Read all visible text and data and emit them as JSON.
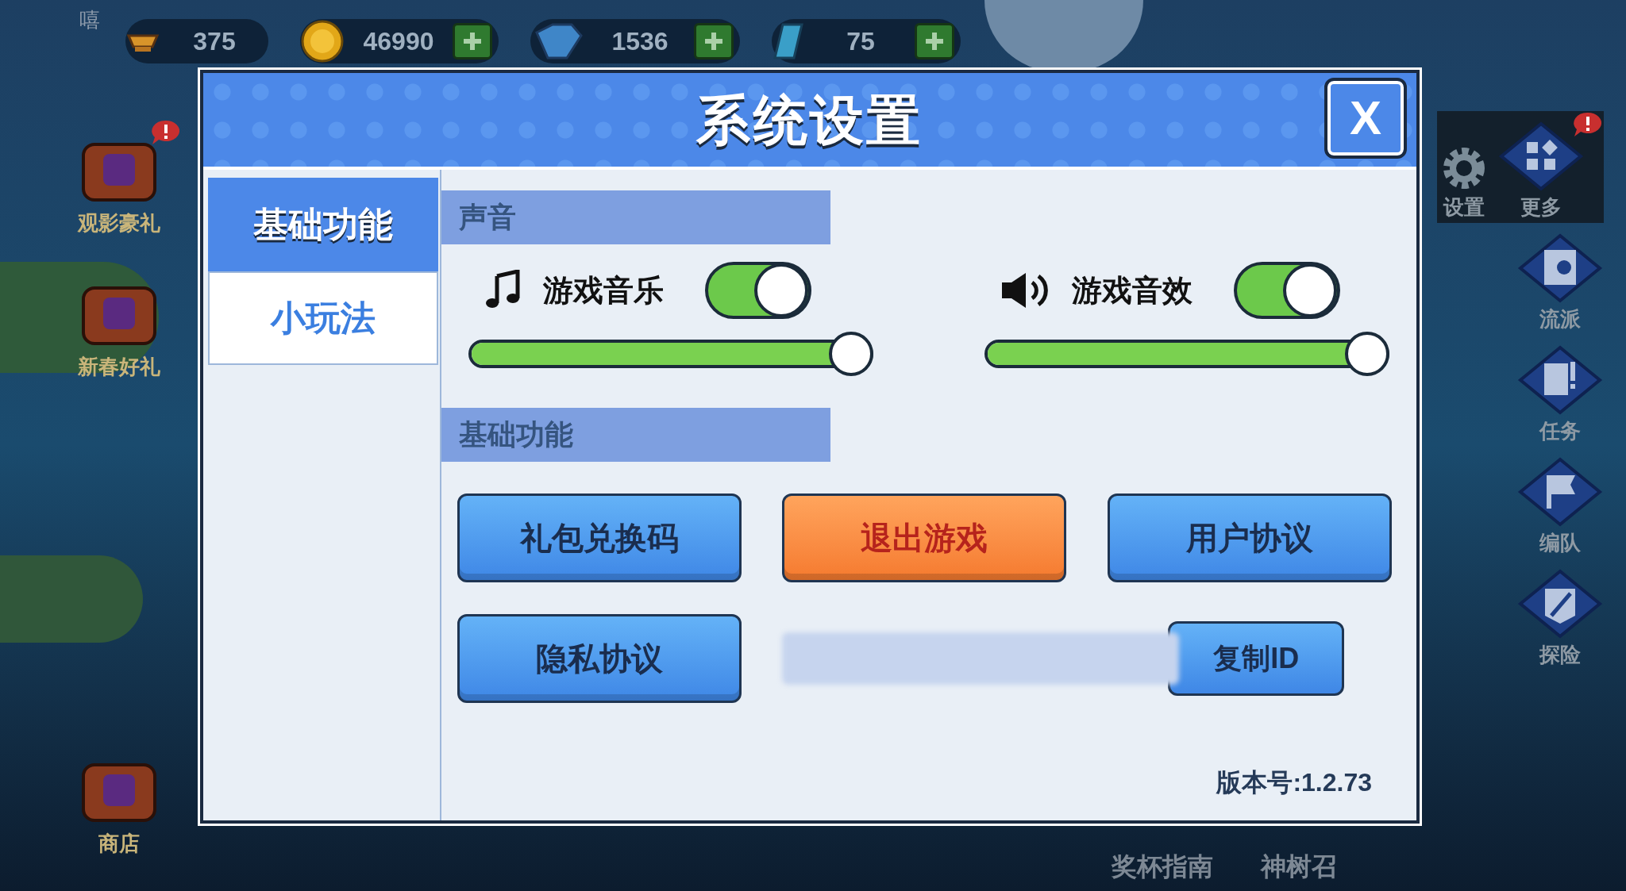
{
  "top_bar": {
    "player_label": "嘻",
    "currencies": [
      {
        "kind": "trophy",
        "amount": "375",
        "addable": false
      },
      {
        "kind": "coin",
        "amount": "46990",
        "addable": true
      },
      {
        "kind": "gem",
        "amount": "1536",
        "addable": true
      },
      {
        "kind": "crystal",
        "amount": "75",
        "addable": true
      }
    ]
  },
  "left_menu": [
    {
      "label": "观影豪礼",
      "alert": true
    },
    {
      "label": "新春好礼",
      "alert": false
    },
    {
      "label": "商店",
      "alert": false
    }
  ],
  "right_menu": [
    {
      "label": "设置",
      "kind": "gear",
      "alert": false
    },
    {
      "label": "更多",
      "kind": "grid",
      "alert": true
    },
    {
      "label": "流派",
      "kind": "book",
      "alert": false
    },
    {
      "label": "任务",
      "kind": "scroll",
      "alert": false
    },
    {
      "label": "编队",
      "kind": "flag",
      "alert": false
    },
    {
      "label": "探险",
      "kind": "sword",
      "alert": false
    }
  ],
  "bottom_bar": [
    "奖杯指南",
    "神树召"
  ],
  "dialog": {
    "title": "系统设置",
    "close_label": "X",
    "tabs": [
      {
        "label": "基础功能",
        "selected": true
      },
      {
        "label": "小玩法",
        "selected": false
      }
    ],
    "sound": {
      "title": "声音",
      "channels": [
        {
          "kind": "music",
          "label": "游戏音乐",
          "on": true,
          "level": 1
        },
        {
          "kind": "effects",
          "label": "游戏音效",
          "on": true,
          "level": 1
        }
      ]
    },
    "basic": {
      "title": "基础功能",
      "buttons": [
        {
          "label": "礼包兑换码",
          "kind": "primary"
        },
        {
          "label": "退出游戏",
          "kind": "danger"
        },
        {
          "label": "用户协议",
          "kind": "primary"
        },
        {
          "label": "隐私协议",
          "kind": "primary"
        }
      ],
      "copy_label": "复制ID",
      "version": "版本号:1.2.73"
    }
  }
}
